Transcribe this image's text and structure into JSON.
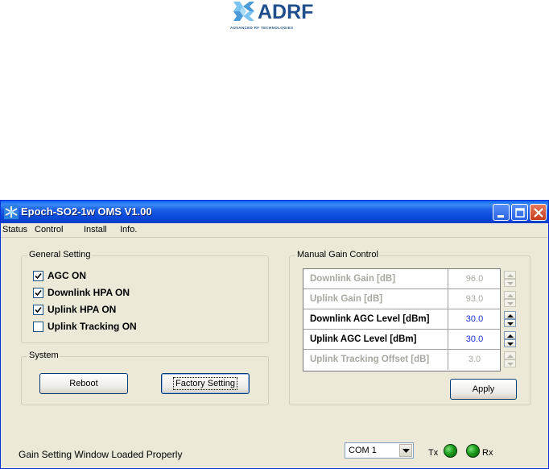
{
  "logo": {
    "word": "ADRF",
    "tagline": "ADVANCED RF TECHNOLOGIES",
    "colors": {
      "primary": "#1e4f8c",
      "accent": "#5ab0e8"
    }
  },
  "window": {
    "title": "Epoch-SO2-1w OMS V1.00",
    "icon": "snowflake-app-icon",
    "controls": [
      "minimize",
      "maximize",
      "close"
    ]
  },
  "menu": {
    "items": [
      {
        "label": "Status"
      },
      {
        "label": "Control"
      },
      {
        "label": "Install"
      },
      {
        "label": "Info."
      }
    ]
  },
  "general": {
    "title": "General Setting",
    "checks": [
      {
        "label": "AGC ON",
        "checked": true
      },
      {
        "label": "Downlink HPA ON",
        "checked": true
      },
      {
        "label": "Uplink HPA ON",
        "checked": true
      },
      {
        "label": "Uplink Tracking ON",
        "checked": false
      }
    ]
  },
  "system": {
    "title": "System",
    "reboot_label": "Reboot",
    "factory_label": "Factory Setting"
  },
  "manual": {
    "title": "Manual Gain Control",
    "rows": [
      {
        "label": "Downlink Gain [dB]",
        "value": "96.0",
        "enabled": false
      },
      {
        "label": "Uplink Gain [dB]",
        "value": "93.0",
        "enabled": false
      },
      {
        "label": "Downlink AGC Level [dBm]",
        "value": "30.0",
        "enabled": true
      },
      {
        "label": "Uplink AGC Level [dBm]",
        "value": "30.0",
        "enabled": true
      },
      {
        "label": "Uplink Tracking Offset [dB]",
        "value": "3.0",
        "enabled": false
      }
    ],
    "apply_label": "Apply"
  },
  "statusbar": {
    "message": "Gain Setting Window Loaded Properly",
    "com_port": "COM 1",
    "tx_label": "Tx",
    "rx_label": "Rx",
    "led_color": "#1a9c1a"
  }
}
